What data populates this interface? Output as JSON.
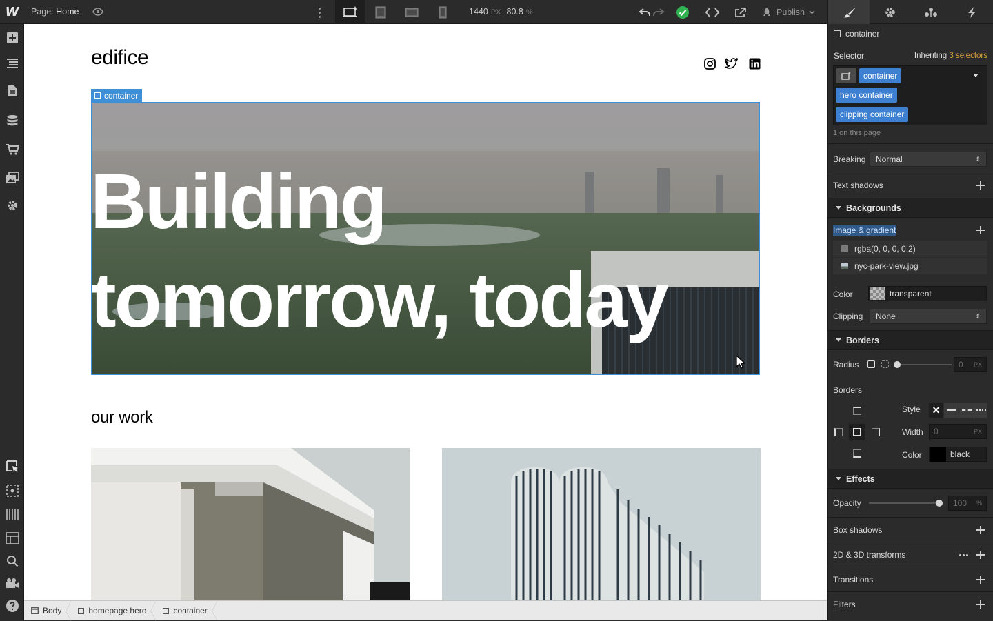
{
  "topbar": {
    "logo": "W",
    "page_prefix": "Page:",
    "page_name": "Home",
    "width_value": "1440",
    "width_unit": "PX",
    "zoom_value": "80.8",
    "zoom_unit": "%",
    "publish_label": "Publish"
  },
  "canvas": {
    "brand": "edifice",
    "selected_badge": "container",
    "hero_headline": "Building tomorrow, today",
    "section_title": "our work"
  },
  "breadcrumb": {
    "items": [
      "Body",
      "homepage hero",
      "container"
    ]
  },
  "panel": {
    "element_name": "container",
    "selector_label": "Selector",
    "inheriting_prefix": "Inheriting",
    "inheriting_count": "3 selectors",
    "selector_chips": [
      "container",
      "hero container",
      "clipping container"
    ],
    "on_page": "1 on this page",
    "breaking_label": "Breaking",
    "breaking_value": "Normal",
    "text_shadows_label": "Text shadows",
    "backgrounds_title": "Backgrounds",
    "image_gradient_label": "Image & gradient",
    "bg_layers": [
      "rgba(0, 0, 0, 0.2)",
      "nyc-park-view.jpg"
    ],
    "color_label": "Color",
    "color_value": "transparent",
    "clipping_label": "Clipping",
    "clipping_value": "None",
    "borders_title": "Borders",
    "radius_label": "Radius",
    "radius_value": "0",
    "radius_unit": "PX",
    "borders_label": "Borders",
    "style_label": "Style",
    "width_label": "Width",
    "width_value": "0",
    "width_unit": "PX",
    "border_color_label": "Color",
    "border_color_value": "black",
    "effects_title": "Effects",
    "opacity_label": "Opacity",
    "opacity_value": "100",
    "opacity_unit": "%",
    "box_shadows_label": "Box shadows",
    "transforms_label": "2D & 3D transforms",
    "transitions_label": "Transitions",
    "filters_label": "Filters"
  },
  "colors": {
    "accent": "#3e8fd6",
    "chip": "#3d7fd0",
    "panel_bg": "#2b2b2b",
    "check": "#2fb24f",
    "inherit_highlight": "#d9a33a"
  },
  "icons": {
    "left_sidebar": [
      "add-icon",
      "navigator-icon",
      "pages-icon",
      "cms-icon",
      "ecommerce-icon",
      "assets-icon",
      "settings-icon",
      "select-icon",
      "preview-icon",
      "grid-icon",
      "layout-icon",
      "search-icon",
      "video-icon",
      "help-icon"
    ],
    "panel_tabs": [
      "style-brush-icon",
      "gear-icon",
      "interactions-icon",
      "lightning-icon"
    ]
  }
}
